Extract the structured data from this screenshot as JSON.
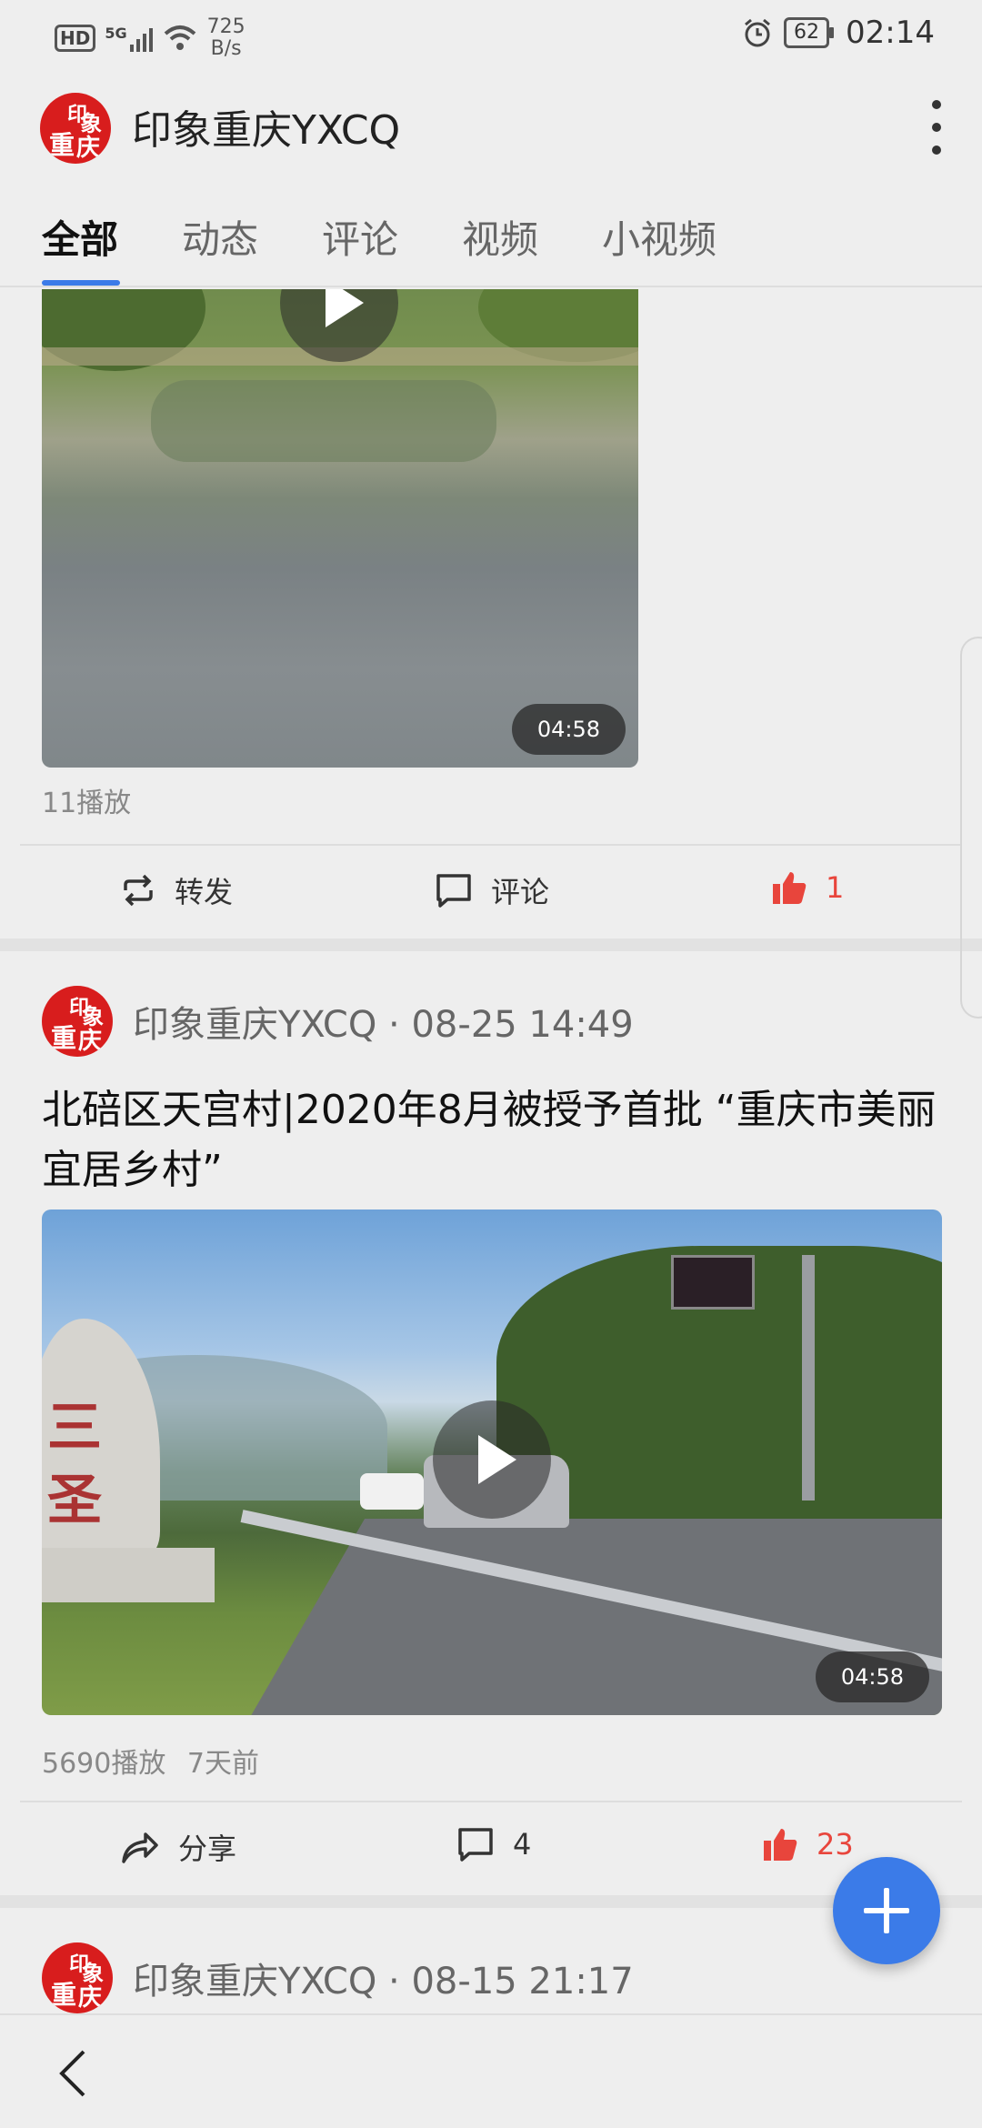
{
  "status_bar": {
    "hd": "HD",
    "network": "5G",
    "speed_value": "725",
    "speed_unit": "B/s",
    "battery": "62",
    "time": "02:14"
  },
  "header": {
    "avatar_text": "印象重庆",
    "title": "印象重庆YXCQ",
    "menu_icon": "more-vertical-icon"
  },
  "tabs": [
    {
      "label": "全部",
      "active": true
    },
    {
      "label": "动态",
      "active": false
    },
    {
      "label": "评论",
      "active": false
    },
    {
      "label": "视频",
      "active": false
    },
    {
      "label": "小视频",
      "active": false
    }
  ],
  "posts": [
    {
      "video_duration": "04:58",
      "plays": "11播放",
      "actions": {
        "share_label": "转发",
        "comment_label": "评论",
        "like_count": "1"
      }
    },
    {
      "author": "印象重庆YXCQ · 08-25 14:49",
      "title": "北碚区天宫村|2020年8月被授予首批 “重庆市美丽宜居乡村”",
      "video_duration": "04:58",
      "plays": "5690播放",
      "time_ago": "7天前",
      "actions": {
        "share_label": "分享",
        "comment_count": "4",
        "like_count": "23"
      }
    },
    {
      "author": "印象重庆YXCQ · 08-15 21:17"
    }
  ],
  "colors": {
    "accent": "#3b7be8",
    "like": "#e8453c",
    "brand_red": "#d81d1d"
  }
}
